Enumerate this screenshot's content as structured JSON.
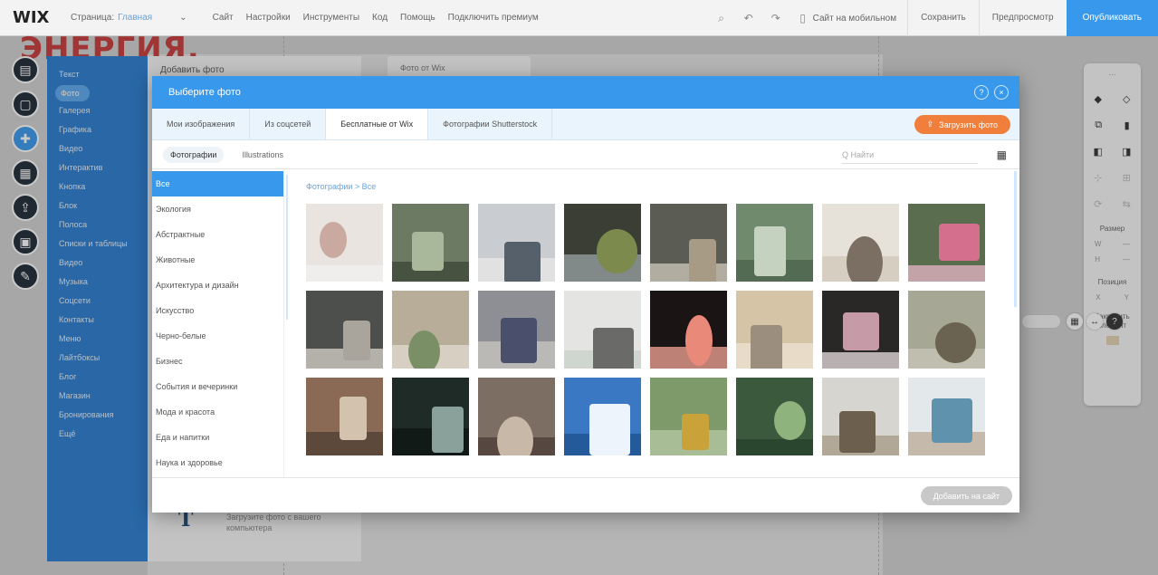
{
  "topbar": {
    "logo": "WIX",
    "page_label": "Страница:",
    "page_name": "Главная",
    "menu": [
      "Сайт",
      "Настройки",
      "Инструменты",
      "Код",
      "Помощь",
      "Подключить премиум"
    ],
    "undo_icon": "undo-icon",
    "redo_icon": "redo-icon",
    "zoom_icon": "zoom-icon",
    "mobile_toggle": "Сайт на мобильном",
    "save": "Сохранить",
    "preview": "Предпросмотр",
    "publish": "Опубликовать"
  },
  "canvas": {
    "brand_text": "ЭНЕРГИЯ."
  },
  "rail": [
    "pages-icon",
    "background-icon",
    "add-icon",
    "apps-icon",
    "upload-icon",
    "store-icon",
    "blog-icon"
  ],
  "add_panel": {
    "items": [
      "Текст",
      "Фото",
      "Галерея",
      "Графика",
      "Видео",
      "Интерактив",
      "Кнопка",
      "Блок",
      "Полоса",
      "Списки и таблицы",
      "Видео",
      "Музыка",
      "Соцсети",
      "Контакты",
      "Меню",
      "Лайтбоксы",
      "Блог",
      "Магазин",
      "Бронирования",
      "Ещё"
    ],
    "selected_index": 1
  },
  "sub_panel": {
    "title": "Добавить фото",
    "panel2_title": "Фото от Wix",
    "upload_text": "Загрузите фото с вашего компьютера"
  },
  "modal": {
    "title": "Выберите фото",
    "tabs": [
      "Мои изображения",
      "Из соцсетей",
      "Бесплатные от Wix",
      "Фотографии Shutterstock"
    ],
    "active_tab": 2,
    "upload_button": "Загрузить фото",
    "subtabs": [
      "Фотографии",
      "Illustrations"
    ],
    "search_placeholder": "Q Найти",
    "categories": [
      "Все",
      "Экология",
      "Абстрактные",
      "Животные",
      "Архитектура и дизайн",
      "Искусство",
      "Черно-белые",
      "Бизнес",
      "События и вечеринки",
      "Мода и красота",
      "Еда и напитки",
      "Наука и здоровье"
    ],
    "breadcrumb": "Фотографии > Все",
    "footer_button": "Добавить на сайт",
    "photos": [
      {
        "bg": "#e9e4df",
        "fg": "#c9a9a0",
        "accent": "#f2f2f0"
      },
      {
        "bg": "#6d7a63",
        "fg": "#a9b89a",
        "accent": "#3c4536"
      },
      {
        "bg": "#c9ccd0",
        "fg": "#55606a",
        "accent": "#e8e8e8"
      },
      {
        "bg": "#3a3e35",
        "fg": "#7d8a4e",
        "accent": "#9aa3a6"
      },
      {
        "bg": "#5b5d55",
        "fg": "#a89b85",
        "accent": "#cfc8bb"
      },
      {
        "bg": "#6f8a6c",
        "fg": "#c6d2c0",
        "accent": "#49604a"
      },
      {
        "bg": "#e6e2d9",
        "fg": "#7a6f62",
        "accent": "#cfc7b8"
      },
      {
        "bg": "#5b6d4f",
        "fg": "#d46f8d",
        "accent": "#e6b5c4"
      },
      {
        "bg": "#4d4f4c",
        "fg": "#a9a59c",
        "accent": "#d6d2c8"
      },
      {
        "bg": "#b8ad98",
        "fg": "#7a8f66",
        "accent": "#e2dcd0"
      },
      {
        "bg": "#8d8f95",
        "fg": "#4a4f6b",
        "accent": "#c9c7c2"
      },
      {
        "bg": "#e4e4e2",
        "fg": "#6a6a68",
        "accent": "#c8d1c8"
      },
      {
        "bg": "#1a1414",
        "fg": "#e9897a",
        "accent": "#f4a796"
      },
      {
        "bg": "#d6c4a7",
        "fg": "#9c8e7f",
        "accent": "#ede3d2"
      },
      {
        "bg": "#2a2826",
        "fg": "#c79aa8",
        "accent": "#e8dde0"
      },
      {
        "bg": "#a6a895",
        "fg": "#6b6352",
        "accent": "#c8c6b8"
      },
      {
        "bg": "#8a6a55",
        "fg": "#d3c2ad",
        "accent": "#4e3e34"
      },
      {
        "bg": "#1f2b27",
        "fg": "#8aa09b",
        "accent": "#0f1513"
      },
      {
        "bg": "#7d6e64",
        "fg": "#c8b8a8",
        "accent": "#4a3c34"
      },
      {
        "bg": "#3a78c4",
        "fg": "#eef4fb",
        "accent": "#1d4f8c"
      },
      {
        "bg": "#7f9a6a",
        "fg": "#c9a23a",
        "accent": "#b6c7a6"
      },
      {
        "bg": "#3b5a3d",
        "fg": "#8fb37c",
        "accent": "#26402a"
      },
      {
        "bg": "#d7d5cf",
        "fg": "#6d5f4d",
        "accent": "#a59884"
      },
      {
        "bg": "#e3e8ea",
        "fg": "#5f93ad",
        "accent": "#b9a996"
      }
    ]
  },
  "tool_panel": {
    "label_size": "Размер",
    "label_pos": "Позиция",
    "label_lock": "Закрепить элемент"
  },
  "colors": {
    "accent": "#3899ec",
    "upload": "#f07f3c",
    "panel": "#2a7dd1"
  }
}
